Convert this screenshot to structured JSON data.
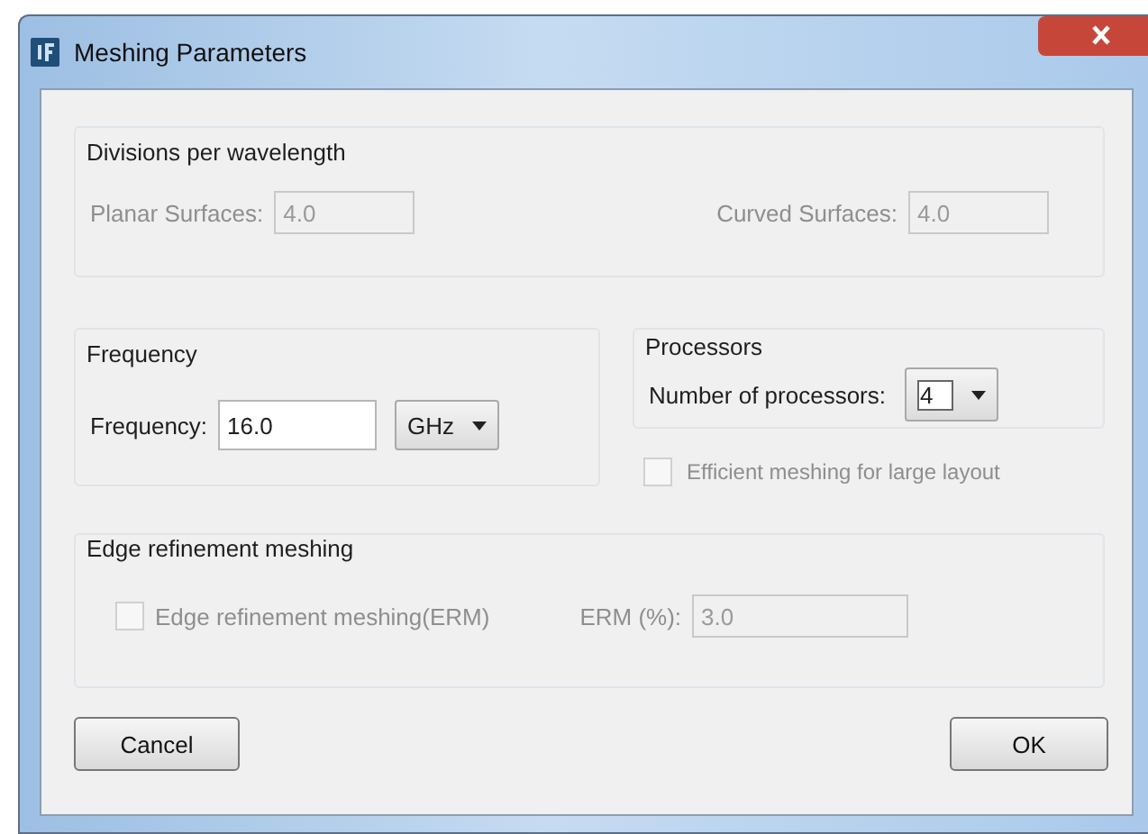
{
  "window": {
    "title": "Meshing Parameters"
  },
  "divisions": {
    "title": "Divisions per wavelength",
    "fields": [
      {
        "label": "Planar Surfaces:",
        "value": "4.0",
        "disabled": true
      },
      {
        "label": "Curved Surfaces:",
        "value": "4.0",
        "disabled": true
      }
    ]
  },
  "frequency": {
    "title": "Frequency",
    "label": "Frequency:",
    "value": "16.0",
    "unit": "GHz"
  },
  "processors": {
    "title": "Processors",
    "label": "Number of processors:",
    "value": "4"
  },
  "efficient_meshing": {
    "label": "Efficient meshing for large layout",
    "checked": false,
    "disabled": true
  },
  "edge_refinement": {
    "title": "Edge refinement meshing",
    "checkbox": {
      "label": "Edge refinement meshing(ERM)",
      "checked": false,
      "disabled": true
    },
    "field": {
      "label": "ERM (%):",
      "value": "3.0",
      "disabled": true
    }
  },
  "buttons": [
    "Cancel",
    "OK"
  ]
}
